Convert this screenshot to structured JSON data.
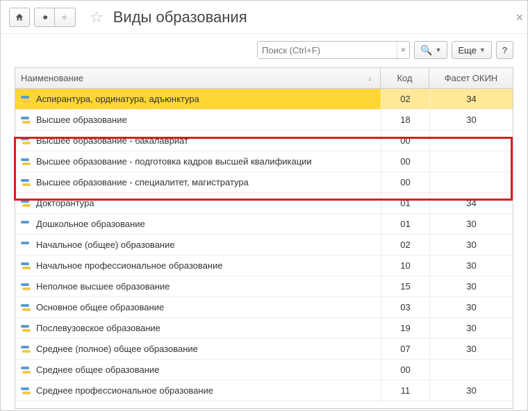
{
  "page_title": "Виды образования",
  "search": {
    "placeholder": "Поиск (Ctrl+F)"
  },
  "buttons": {
    "more": "Еще",
    "help": "?"
  },
  "columns": {
    "name": "Наименование",
    "code": "Код",
    "facet": "Фасет ОКИН"
  },
  "selected_index": 0,
  "highlight_range": [
    2,
    4
  ],
  "rows": [
    {
      "name": "Аспирантура, ординатура, адъюнктура",
      "code": "02",
      "facet": "34",
      "iconYellow": true
    },
    {
      "name": "Высшее образование",
      "code": "18",
      "facet": "30",
      "iconYellow": true
    },
    {
      "name": "Высшее образование - бакалавриат",
      "code": "00",
      "facet": "",
      "iconYellow": true
    },
    {
      "name": "Высшее образование - подготовка кадров высшей квалификации",
      "code": "00",
      "facet": "",
      "iconYellow": true
    },
    {
      "name": "Высшее образование - специалитет, магистратура",
      "code": "00",
      "facet": "",
      "iconYellow": true
    },
    {
      "name": "Докторантура",
      "code": "01",
      "facet": "34",
      "iconYellow": true
    },
    {
      "name": "Дошкольное образование",
      "code": "01",
      "facet": "30",
      "iconYellow": false
    },
    {
      "name": "Начальное (общее) образование",
      "code": "02",
      "facet": "30",
      "iconYellow": false
    },
    {
      "name": "Начальное профессиональное образование",
      "code": "10",
      "facet": "30",
      "iconYellow": true
    },
    {
      "name": "Неполное высшее образование",
      "code": "15",
      "facet": "30",
      "iconYellow": true
    },
    {
      "name": "Основное общее образование",
      "code": "03",
      "facet": "30",
      "iconYellow": true
    },
    {
      "name": "Послевузовское образование",
      "code": "19",
      "facet": "30",
      "iconYellow": true
    },
    {
      "name": "Среднее (полное) общее образование",
      "code": "07",
      "facet": "30",
      "iconYellow": true
    },
    {
      "name": "Среднее общее образование",
      "code": "00",
      "facet": "",
      "iconYellow": true
    },
    {
      "name": "Среднее профессиональное образование",
      "code": "11",
      "facet": "30",
      "iconYellow": true
    }
  ]
}
